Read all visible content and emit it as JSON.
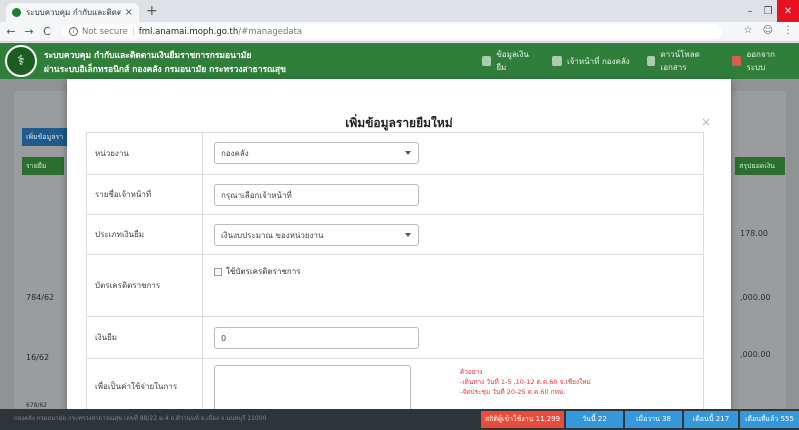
{
  "browser": {
    "tab_title": "ระบบควบคุม กำกับและติดตามเงินยืมฯ",
    "tab_close": "×",
    "new_tab": "+",
    "security": "Not secure",
    "url_host": "fml.anamai.moph.go.th",
    "url_path": "/#managedata",
    "window_min": "–",
    "window_max": "❐",
    "window_close": "✕"
  },
  "header": {
    "brand_line1": "ระบบควบคุม กำกับและติดตามเงินยืมราชการกรมอนามัย",
    "brand_line2": "ผ่านระบบอิเล็กทรอนิกส์ กองคลัง กรมอนามัย กระทรวงสาธารณสุข",
    "nav": [
      {
        "label": "ข้อมูลเงินยืม",
        "icon": "money-icon"
      },
      {
        "label": "เจ้าหน้าที่ กองคลัง",
        "icon": "user-icon"
      },
      {
        "label": "ดาวน์โหลดเอกสาร",
        "icon": "document-icon"
      },
      {
        "label": "ออกจากระบบ",
        "icon": "logout-icon"
      }
    ]
  },
  "background": {
    "add_button": "เพิ่มข้อมูลรา",
    "col_left": "รายยืม",
    "col_right": "สรุปยอดเงิน",
    "rows": [
      "784/62",
      "16/62",
      "678/62"
    ],
    "amounts": [
      "178.00",
      ",000.00",
      ",000.00"
    ]
  },
  "modal": {
    "title": "เพิ่มข้อมูลรายยืมใหม่",
    "close": "×",
    "fields": {
      "department": {
        "label": "หน่วยงาน",
        "value": "กองคลัง"
      },
      "officer": {
        "label": "รายชื่อเจ้าหน้าที่",
        "placeholder": "กรุณาเลือกเจ้าหน้าที่"
      },
      "loan_type": {
        "label": "ประเภทเงินยืม",
        "value": "เงินงบประมาณ ของหน่วยงาน"
      },
      "credit_card": {
        "label": "บัตรเครดิตราชการ",
        "checkbox_label": "ใช้บัตรเครดิตราชการ"
      },
      "amount": {
        "label": "เงินยืม",
        "value": "0"
      },
      "purpose": {
        "label": "เพื่อเป็นค่าใช้จ่ายในการ"
      }
    },
    "hint": {
      "title": "ตัวอย่าง",
      "line1": "-เดินทาง วันที่ 1-5 ,10-12 ต.ค.60 จ.เชียงใหม่",
      "line2": "-จัดประชุม วันที่ 20-25 ต.ค.60 กทม."
    }
  },
  "footer": {
    "text": "กองคลัง กรมอนามัย กระทรวงสาธารณสุข เลขที่ 88/22 ม.4 ถ.ติวานนท์ อ.เมือง จ.นนทบุรี 11000",
    "stats": [
      {
        "label": "สถิติผู้เข้าใช้งาน 11,299",
        "color": "#e74c3c"
      },
      {
        "label": "วันนี้ 22",
        "color": "#3498db"
      },
      {
        "label": "เมื่อวาน 38",
        "color": "#3498db"
      },
      {
        "label": "เดือนนี้ 217",
        "color": "#3498db"
      },
      {
        "label": "เดือนที่แล้ว 555",
        "color": "#3498db"
      }
    ]
  }
}
